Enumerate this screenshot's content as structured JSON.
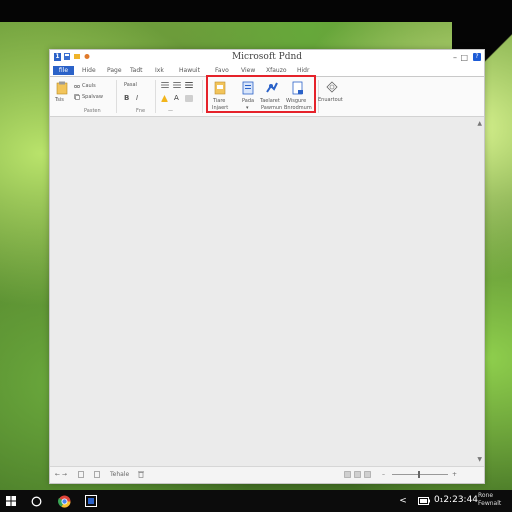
{
  "window": {
    "title": "Microsoft Pdnd",
    "file_tab": "file",
    "tabs": [
      "Hide",
      "Page",
      "Tadt",
      "Ixk",
      "Hawuit",
      "Favo",
      "View",
      "Xfauzo",
      "Hidr"
    ],
    "help": "?"
  },
  "ribbon": {
    "clipboard": {
      "paste": "Tsis",
      "cut": "Cauls",
      "copy": "Spalvaw",
      "label": "Pasten"
    },
    "font": {
      "label": "Pasal",
      "group_label": "Fne"
    },
    "insert_group": {
      "items": [
        {
          "label1": "Tiare",
          "label2": "Injaert"
        },
        {
          "label1": "Pada",
          "label2": ""
        },
        {
          "label1": "Taelaret",
          "label2": "Pawmun"
        },
        {
          "label1": "Wisgure",
          "label2": "Bnrodmum"
        }
      ]
    },
    "extra": {
      "label": "Enuartout"
    }
  },
  "statusbar": {
    "left": "← →",
    "word_count": "Tehale",
    "zoom_marker": "—"
  },
  "taskbar": {
    "clock": "0₁2:23:44",
    "notification": [
      "Rone",
      "Fewnalt"
    ]
  },
  "colors": {
    "accent": "#2b62c8",
    "highlight": "#e5222a",
    "taskbar": "#0c0c0c"
  }
}
